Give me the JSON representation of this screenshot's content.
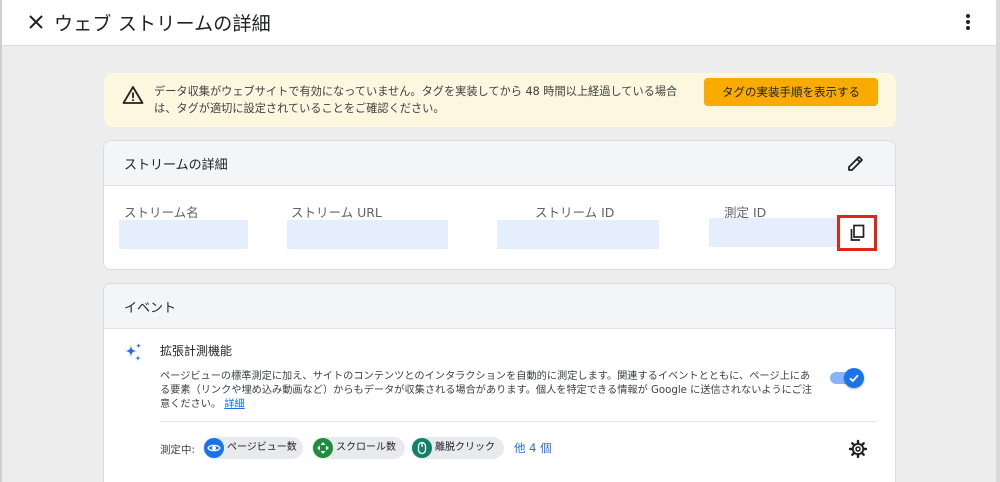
{
  "header": {
    "title": "ウェブ ストリームの詳細"
  },
  "banner": {
    "text": "データ収集がウェブサイトで有効になっていません。タグを実装してから 48 時間以上経過している場合は、タグが適切に設定されていることをご確認ください。",
    "button_label": "タグの実装手順を表示する",
    "color": "#fef7e0",
    "button_color": "#f9ab00"
  },
  "stream_details": {
    "title": "ストリームの詳細",
    "fields": [
      {
        "label": "ストリーム名",
        "value": ""
      },
      {
        "label": "ストリーム URL",
        "value": ""
      },
      {
        "label": "ストリーム ID",
        "value": ""
      },
      {
        "label": "測定 ID",
        "value": ""
      }
    ],
    "highlight_color": "#e1251b"
  },
  "events": {
    "title": "イベント",
    "enhanced": {
      "title": "拡張計測機能",
      "description_prefix": "ページビューの標準測定に加え、サイトのコンテンツとのインタラクションを自動的に測定します。関連するイベントとともに、ページ上にある要素（リンクや埋め込み動画など）からもデータが収集される場合があります。個人を特定できる情報が Google に送信されないようにご注意ください。",
      "description_link": "詳細",
      "enabled": true
    },
    "measuring_label": "測定中:",
    "chips": [
      {
        "label": "ページビュー数",
        "icon": "eye-icon",
        "color": "#1a73e8"
      },
      {
        "label": "スクロール数",
        "icon": "scroll-icon",
        "color": "#1e8e3e"
      },
      {
        "label": "離脱クリック",
        "icon": "mouse-icon",
        "color": "#12806a"
      }
    ],
    "more_label": "他 4 個",
    "accent": "#1a73e8"
  }
}
